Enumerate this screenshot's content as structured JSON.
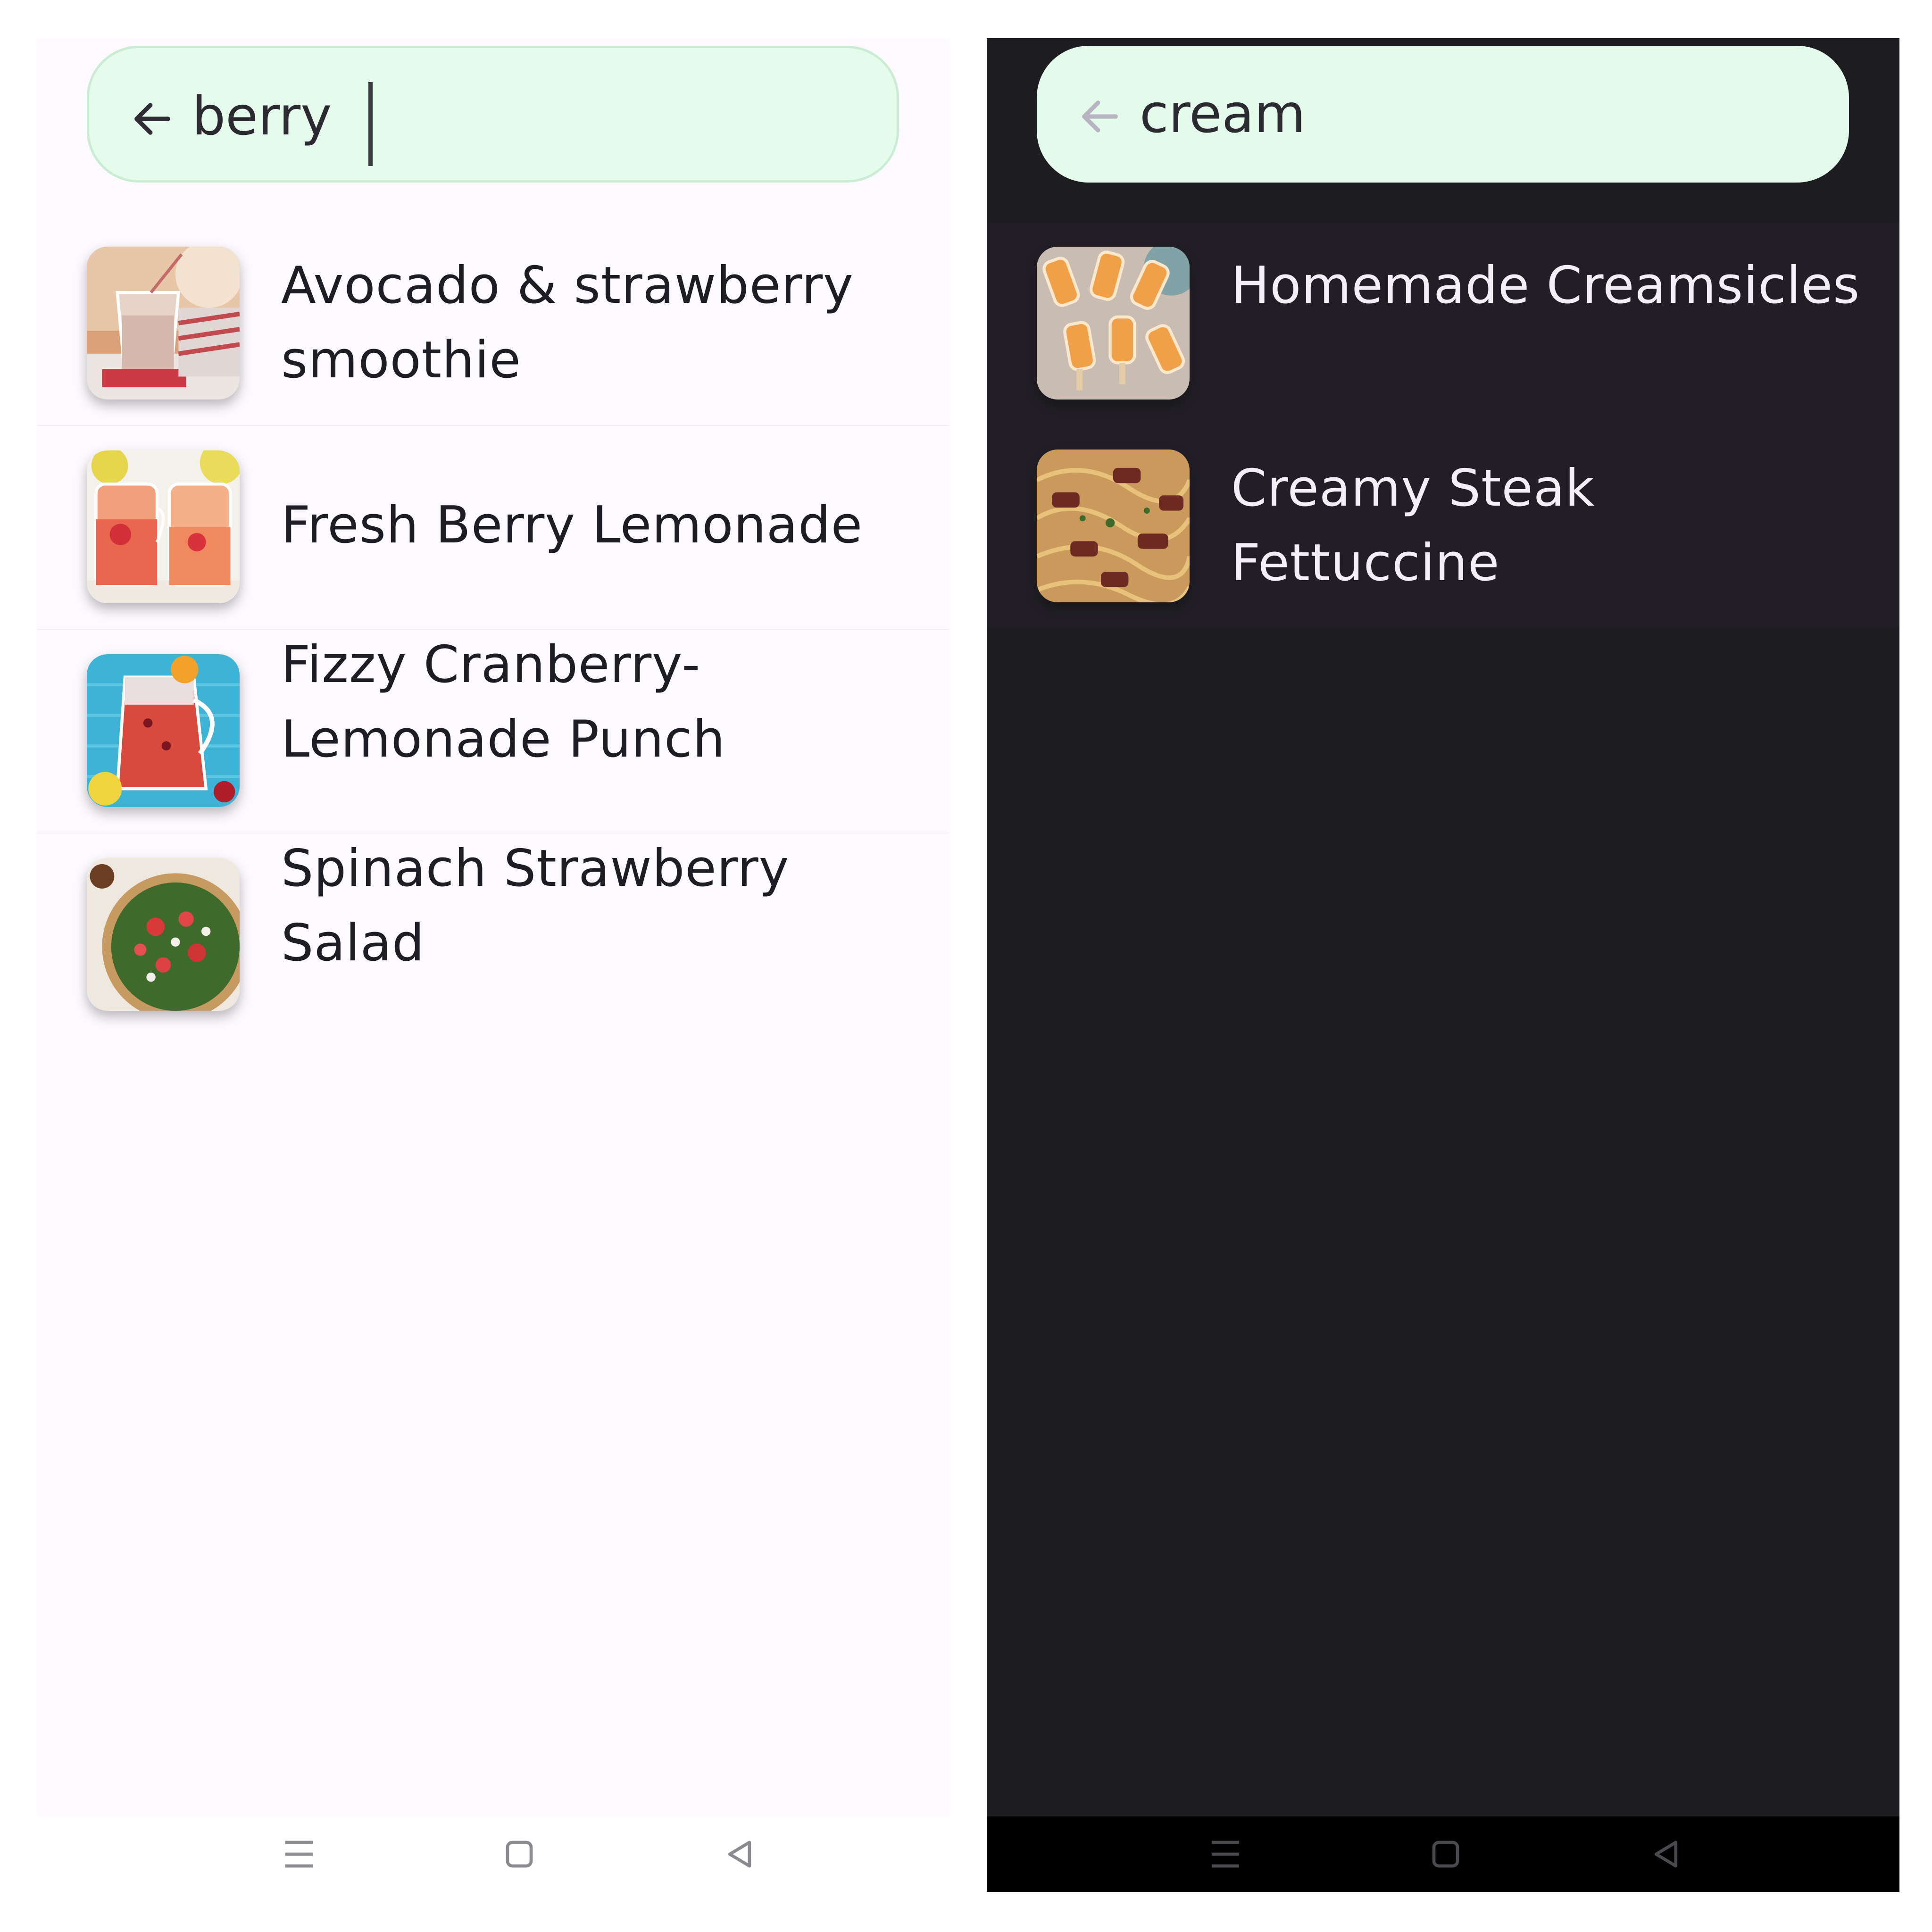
{
  "left_panel": {
    "theme": "light",
    "search": {
      "query": "berry",
      "back_icon": "arrow-left-icon"
    },
    "results": [
      {
        "title": "Avocado & strawberry smoothie",
        "image": "smoothie-photo"
      },
      {
        "title": "Fresh Berry Lemonade",
        "image": "lemonade-jars-photo"
      },
      {
        "title": "Fizzy Cranberry-Lemonade Punch",
        "image": "cranberry-punch-pitcher-photo"
      },
      {
        "title": "Spinach Strawberry Salad",
        "image": "strawberry-spinach-salad-photo"
      }
    ],
    "nav": [
      "recents-icon",
      "home-icon",
      "back-icon"
    ]
  },
  "right_panel": {
    "theme": "dark",
    "search": {
      "query": "cream",
      "back_icon": "arrow-left-icon"
    },
    "results": [
      {
        "title": "Homemade Creamsicles",
        "image": "creamsicle-popsicles-photo"
      },
      {
        "title": "Creamy Steak Fettuccine",
        "image": "steak-fettuccine-photo"
      }
    ],
    "nav": [
      "recents-icon",
      "home-icon",
      "back-icon"
    ]
  },
  "colors": {
    "search_bar_fill": "#e5fbeb",
    "light_background": "#fdfaff",
    "dark_background": "#1d1c21"
  }
}
